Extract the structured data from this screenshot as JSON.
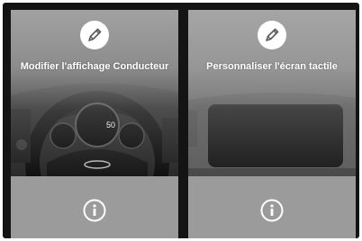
{
  "cards": [
    {
      "title": "Modifier l'affichage Conducteur",
      "edit_icon": "pencil-icon",
      "info_icon": "info-icon",
      "dashboard_speed": "50"
    },
    {
      "title": "Personnaliser l'écran tactile",
      "edit_icon": "pencil-icon",
      "info_icon": "info-icon"
    }
  ],
  "colors": {
    "frame": "#141414",
    "card_bottom": "#9b9b9b",
    "title_text": "#ffffff"
  }
}
